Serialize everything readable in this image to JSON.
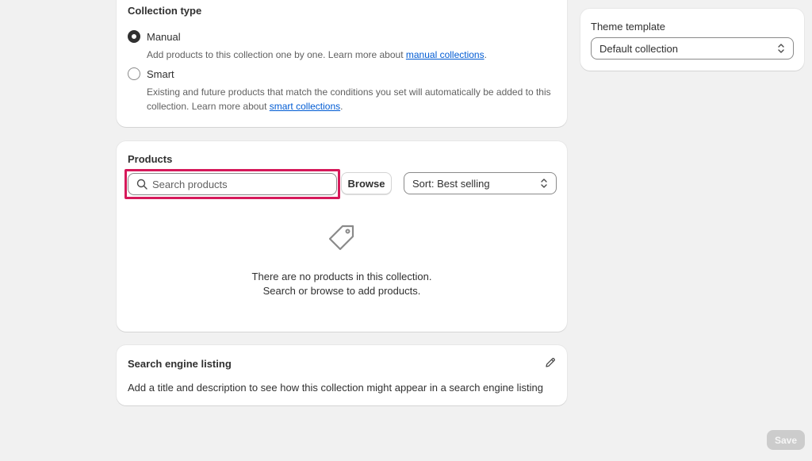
{
  "collection_type": {
    "title": "Collection type",
    "manual": {
      "label": "Manual",
      "help_prefix": "Add products to this collection one by one. Learn more about ",
      "help_link": "manual collections",
      "help_suffix": "."
    },
    "smart": {
      "label": "Smart",
      "help_prefix": "Existing and future products that match the conditions you set will automatically be added to this collection. Learn more about ",
      "help_link": "smart collections",
      "help_suffix": "."
    },
    "selected": "Manual"
  },
  "products": {
    "title": "Products",
    "search_placeholder": "Search products",
    "search_value": "",
    "browse_label": "Browse",
    "sort_value": "Sort: Best selling",
    "empty_line1": "There are no products in this collection.",
    "empty_line2": "Search or browse to add products."
  },
  "seo": {
    "title": "Search engine listing",
    "description": "Add a title and description to see how this collection might appear in a search engine listing"
  },
  "theme": {
    "title": "Theme template",
    "value": "Default collection"
  },
  "save_label": "Save",
  "icons": {
    "search": "search-icon",
    "tag": "tag-icon",
    "edit": "pencil-icon",
    "select": "chevron-up-down-icon"
  },
  "colors": {
    "highlight": "#d6195a",
    "link": "#005bd3",
    "background": "#f1f1f1"
  }
}
